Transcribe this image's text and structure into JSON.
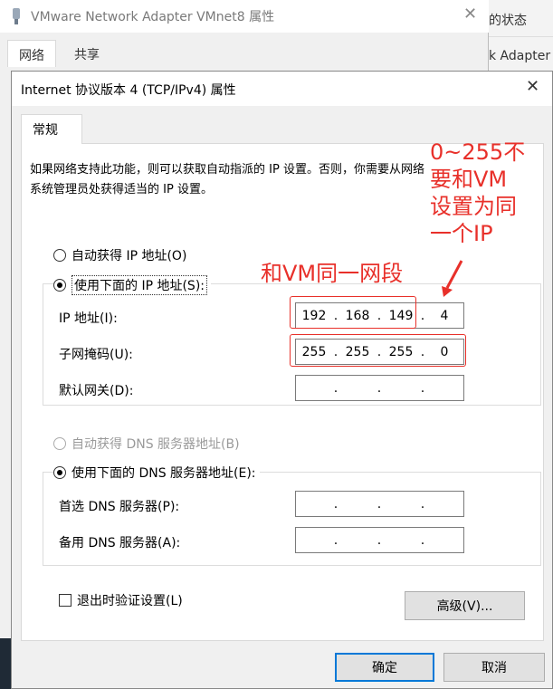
{
  "background_window": {
    "title": "VMware Network Adapter VMnet8 属性",
    "tabs": [
      "网络",
      "共享"
    ],
    "right_strip": [
      "的状态",
      "k Adapter"
    ]
  },
  "dialog": {
    "title": "Internet 协议版本 4 (TCP/IPv4) 属性",
    "tab": "常规",
    "intro_line1": "如果网络支持此功能，则可以获取自动指派的 IP 设置。否则，你需要从网络",
    "intro_line2": "系统管理员处获得适当的 IP 设置。",
    "ip_auto_label": "自动获得 IP 地址(O)",
    "ip_manual_label": "使用下面的 IP 地址(S):",
    "ip_address_label": "IP 地址(I):",
    "ip_address": [
      "192",
      "168",
      "149",
      "4"
    ],
    "subnet_label": "子网掩码(U):",
    "subnet_mask": [
      "255",
      "255",
      "255",
      "0"
    ],
    "gateway_label": "默认网关(D):",
    "gateway": [
      "",
      "",
      "",
      ""
    ],
    "dns_auto_label": "自动获得 DNS 服务器地址(B)",
    "dns_manual_label": "使用下面的 DNS 服务器地址(E):",
    "preferred_dns_label": "首选 DNS 服务器(P):",
    "preferred_dns": [
      "",
      "",
      "",
      ""
    ],
    "alternate_dns_label": "备用 DNS 服务器(A):",
    "alternate_dns": [
      "",
      "",
      "",
      ""
    ],
    "validate_label": "退出时验证设置(L)",
    "advanced_button": "高级(V)...",
    "ok_button": "确定",
    "cancel_button": "取消"
  },
  "annotations": {
    "same_segment": "和VM同一网段",
    "range_note_lines": [
      "0~255不",
      "要和VM",
      "设置为同",
      "一个IP"
    ],
    "color": "#e8302a"
  },
  "colors": {
    "accent": "#0078d7",
    "annotation": "#e8302a"
  }
}
